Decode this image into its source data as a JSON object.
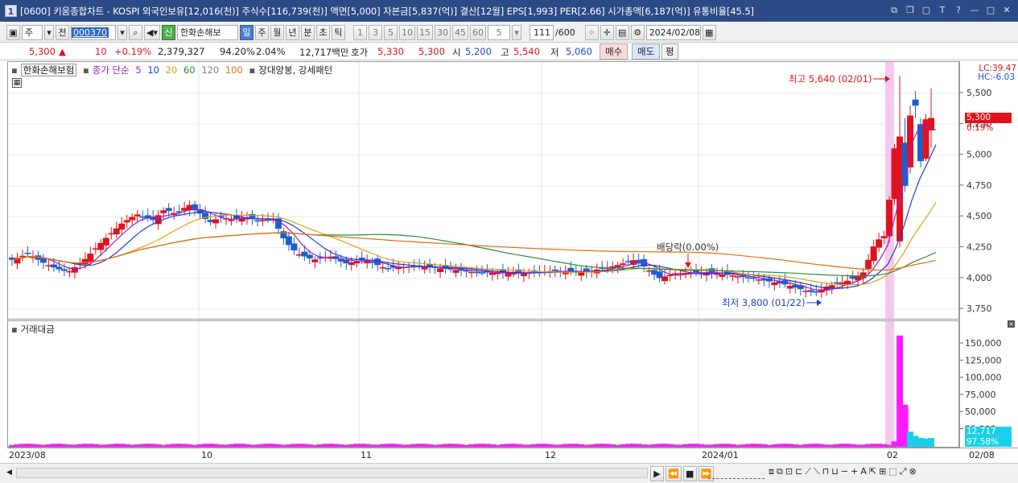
{
  "window": {
    "title": "[0600] 키움종합차트 - KOSPI 외국인보유[12,016(천)] 주식수[116,739(천)] 액면[5,000] 자본금[5,837(억)] 결산[12월] EPS[1,993] PER[2.66] 시가총액[6,187(억)] 유통비율[45.5]",
    "app_icon": "1"
  },
  "toolbar": {
    "period_select": "주",
    "all_label": "전",
    "stock_code": "000370",
    "new_label": "신",
    "stock_name": "한화손해보",
    "period_tabs": [
      "일",
      "주",
      "월",
      "년",
      "분",
      "초",
      "틱"
    ],
    "active_tab": "일",
    "intervals": [
      "1",
      "3",
      "5",
      "10",
      "15",
      "30",
      "45",
      "60"
    ],
    "interval_select": "5",
    "count_value": "111",
    "count_total": "/600",
    "date": "2024/02/08"
  },
  "price_bar": {
    "price": "5,300",
    "change_arrow": "▲",
    "change": "10",
    "change_pct": "+0.19%",
    "volume": "2,379,327",
    "ratio1": "94.20%",
    "ratio2": "2.04%",
    "amount": "12,717백만",
    "ask_label": "호가",
    "ask": "5,330",
    "bid": "5,300",
    "open_label": "시",
    "open": "5,200",
    "high_label": "고",
    "high": "5,540",
    "low_label": "저",
    "low": "5,060",
    "buy_button": "매수",
    "sell_button": "매도",
    "eval_button": "평"
  },
  "legend": {
    "stock": "한화손해보험",
    "ma_label": "종가 단순",
    "ma_periods": [
      "5",
      "10",
      "20",
      "60",
      "120",
      "100"
    ],
    "ma_colors": [
      "#a020c0",
      "#1a3fd0",
      "#e0a010",
      "#2e8b3a",
      "#808080",
      "#e07010"
    ],
    "pattern_label": "장대양봉, 강세패턴"
  },
  "annotations": {
    "high": "최고 5,640 (02/01)",
    "low": "최저 3,800 (01/22)",
    "dividend": "배당락(0.00%)"
  },
  "right_axis": {
    "lc": "LC:39.47",
    "hc": "HC:-6.03",
    "price_ticks": [
      "5,500",
      "5,250",
      "5,000",
      "4,750",
      "4,500",
      "4,250",
      "4,000",
      "3,750"
    ],
    "current_price": "5,300",
    "current_pct": "0.19%",
    "volume_ticks": [
      "150,000",
      "125,000",
      "100,000",
      "75,000",
      "50,000",
      "25,000"
    ],
    "current_volume": "12,717",
    "current_volume_pct": "97.58%"
  },
  "volume_panel": {
    "title": "거래대금"
  },
  "x_axis": {
    "labels": [
      "2023/08",
      "10",
      "11",
      "12",
      "2024/01",
      "02",
      "02/08"
    ]
  },
  "colors": {
    "up": "#e0121b",
    "down": "#1a5fd0",
    "volume": "#ff1aff",
    "volume_recent": "#1ad0e8"
  },
  "chart_data": {
    "type": "candlestick",
    "period": "daily",
    "date_range": [
      "2023/08",
      "2024/02/08"
    ],
    "ylim": [
      3700,
      5700
    ],
    "candles_sample": [
      {
        "date": "2023/08",
        "open": 4120,
        "high": 4220,
        "low": 4080,
        "close": 4150
      },
      {
        "date": "2023/09",
        "open": 4400,
        "high": 4620,
        "low": 4380,
        "close": 4550
      },
      {
        "date": "2023/10",
        "open": 4450,
        "high": 4680,
        "low": 4280,
        "close": 4320
      },
      {
        "date": "2023/11",
        "open": 4200,
        "high": 4250,
        "low": 4050,
        "close": 4100
      },
      {
        "date": "2023/12",
        "open": 4080,
        "high": 4180,
        "low": 4000,
        "close": 4060
      },
      {
        "date": "2024/01/22",
        "open": 3900,
        "high": 3950,
        "low": 3800,
        "close": 3880
      },
      {
        "date": "2024/02/01",
        "open": 4300,
        "high": 5640,
        "low": 4250,
        "close": 5150
      },
      {
        "date": "2024/02/08",
        "open": 5200,
        "high": 5540,
        "low": 5060,
        "close": 5300
      }
    ],
    "volume_sample": [
      {
        "date": "2024/02/01",
        "value": 162000
      },
      {
        "date": "2024/02/02",
        "value": 61000
      },
      {
        "date": "2024/02/08",
        "value": 12717
      }
    ]
  }
}
